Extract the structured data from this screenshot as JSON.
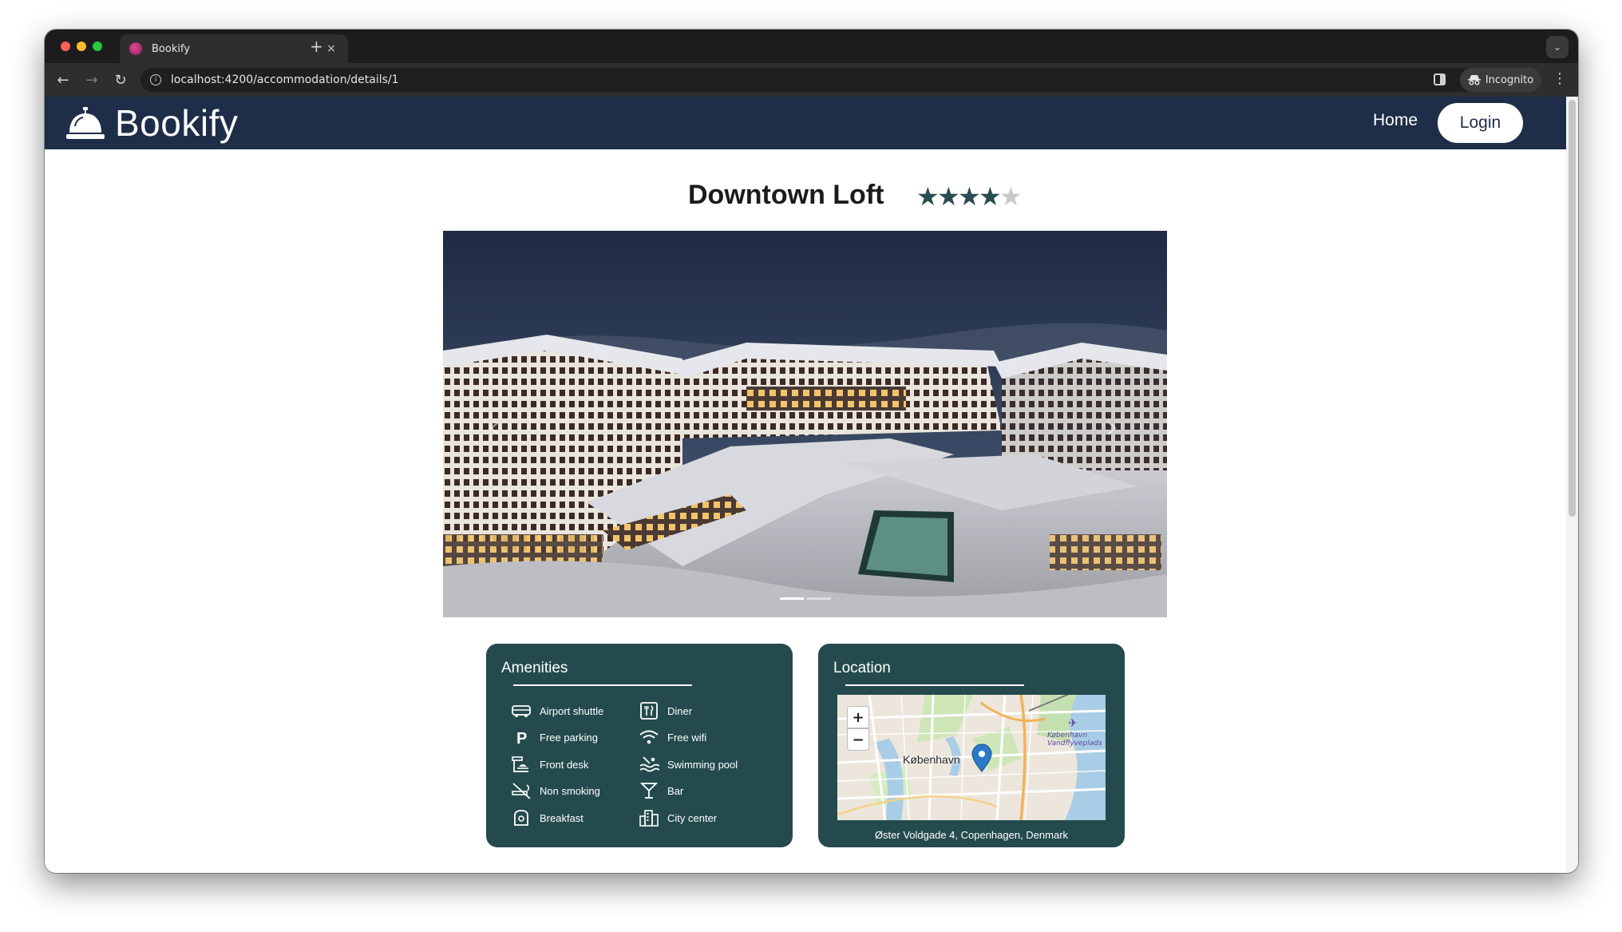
{
  "browser": {
    "tab_title": "Bookify",
    "tab_close": "×",
    "new_tab": "+",
    "url": "localhost:4200/accommodation/details/1",
    "incognito_label": "Incognito"
  },
  "navbar": {
    "brand": "Bookify",
    "home_label": "Home",
    "login_label": "Login"
  },
  "accommodation": {
    "title": "Downtown Loft",
    "rating": 4,
    "rating_max": 5
  },
  "carousel": {
    "image_description": "snow covered hotel resort at dusk",
    "slide_count": 2,
    "active_slide": 1
  },
  "amenities": {
    "title": "Amenities",
    "items": [
      {
        "icon": "shuttle-icon",
        "label": "Airport shuttle"
      },
      {
        "icon": "diner-icon",
        "label": "Diner"
      },
      {
        "icon": "parking-icon",
        "label": "Free parking"
      },
      {
        "icon": "wifi-icon",
        "label": "Free wifi"
      },
      {
        "icon": "front-desk-icon",
        "label": "Front desk"
      },
      {
        "icon": "pool-icon",
        "label": "Swimming pool"
      },
      {
        "icon": "non-smoking-icon",
        "label": "Non smoking"
      },
      {
        "icon": "bar-icon",
        "label": "Bar"
      },
      {
        "icon": "breakfast-icon",
        "label": "Breakfast"
      },
      {
        "icon": "city-center-icon",
        "label": "City center"
      }
    ]
  },
  "location": {
    "title": "Location",
    "map": {
      "city_label": "København",
      "water_label": "København Vandflyveplads",
      "zoom_in": "+",
      "zoom_out": "−"
    },
    "address": "Øster Voldgade 4, Copenhagen, Denmark"
  },
  "colors": {
    "navbar_bg": "#1e2d48",
    "card_bg": "#244a4e",
    "star_filled": "#2a4c52",
    "star_empty": "#c9c9c9"
  }
}
